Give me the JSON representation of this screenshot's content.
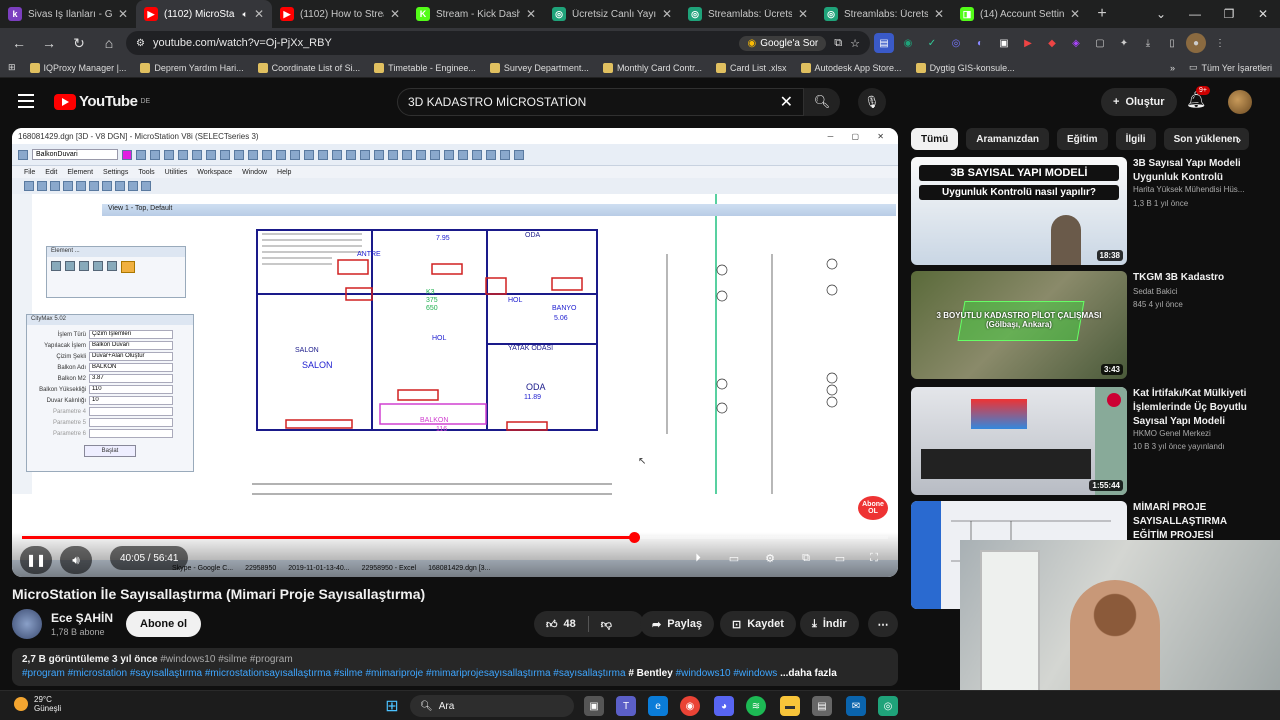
{
  "browser": {
    "tabs": [
      {
        "label": "Sivas İş İlanları - Gün",
        "color": "#7b3fbf",
        "glyph": "k",
        "active": false
      },
      {
        "label": "(1102) MicroSta",
        "color": "#ff0000",
        "glyph": "▶",
        "active": true
      },
      {
        "label": "(1102) How to Strea",
        "color": "#ff0000",
        "glyph": "▶",
        "active": false
      },
      {
        "label": "Stream - Kick Dashb",
        "color": "#53fc18",
        "glyph": "K",
        "active": false
      },
      {
        "label": "Ücretsiz Canlı Yayın v",
        "color": "#1fa37a",
        "glyph": "◎",
        "active": false
      },
      {
        "label": "Streamlabs: Ücretsiz",
        "color": "#1fa37a",
        "glyph": "◎",
        "active": false
      },
      {
        "label": "Streamlabs: Ücretsiz",
        "color": "#1fa37a",
        "glyph": "◎",
        "active": false
      },
      {
        "label": "(14) Account Setting",
        "color": "#53fc18",
        "glyph": "◨",
        "active": false
      }
    ],
    "new_tab": "+",
    "url": "youtube.com/watch?v=Oj-PjXx_RBY",
    "ask_google": "Google'a Sor",
    "bookmarks": [
      "IQProxy Manager |...",
      "Deprem Yardım Hari...",
      "Coordinate List of Si...",
      "Timetable - Enginee...",
      "Survey Department...",
      "Monthly Card Contr...",
      "Card List .xlsx",
      "Autodesk App Store...",
      "Dygtig GIS-konsule..."
    ],
    "bookmarks_more": "»",
    "all_bookmarks": "Tüm Yer İşaretleri"
  },
  "youtube": {
    "logo": "YouTube",
    "country": "DE",
    "search_query": "3D KADASTRO MİCROSTATİON",
    "create_label": "Oluştur",
    "notif_count": "9+"
  },
  "player": {
    "ms_title": "168081429.dgn [3D - V8 DGN] - MicroStation V8i (SELECTseries 3)",
    "ms_level": "BalkonDuvari",
    "ms_menus": [
      "File",
      "Edit",
      "Element",
      "Settings",
      "Tools",
      "Utilities",
      "Workspace",
      "Window",
      "Help"
    ],
    "view_title": "View 1 - Top, Default",
    "element_panel": "Element ...",
    "citymax_title": "CityMax 5.02",
    "citymax_rows": [
      {
        "label": "İşlem Türü",
        "value": "Çizim İşlemleri"
      },
      {
        "label": "Yapılacak İşlem",
        "value": "Balkon Duvarı"
      },
      {
        "label": "Çizim Şekli",
        "value": "Duvar+Alan Oluştur"
      },
      {
        "label": "Balkon Adı",
        "value": "BALKON"
      },
      {
        "label": "Balkon M2",
        "value": "3.87"
      },
      {
        "label": "Balkon Yüksekliği",
        "value": "110"
      },
      {
        "label": "Duvar Kalınlığı",
        "value": "10"
      },
      {
        "label": "Parametre 4",
        "value": ""
      },
      {
        "label": "Parametre 5",
        "value": ""
      },
      {
        "label": "Parametre 6",
        "value": ""
      }
    ],
    "citymax_start": "Başlat",
    "rooms": [
      "SALON",
      "ODA",
      "YATAK ODASI",
      "HOL",
      "BALKON",
      "BANYO",
      "ANTRE"
    ],
    "inner_taskbar": [
      "Skype - Google C...",
      "22958950",
      "2019-11-01-13-40...",
      "22958950 - Excel",
      "168081429.dgn [3..."
    ],
    "time_current": "40:05",
    "time_total": "56:41",
    "progress": 0.707,
    "abone": "Abone OL"
  },
  "video": {
    "title": "MicroStation İle Sayısallaştırma (Mimari Proje Sayısallaştırma)",
    "channel": "Ece ŞAHİN",
    "subscribers": "1,78 B abone",
    "subscribe_label": "Abone ol",
    "likes": "48",
    "share": "Paylaş",
    "save": "Kaydet",
    "download": "İndir",
    "views_time": "2,7 B görüntüleme  3 yıl önce",
    "hashtags_top": "#windows10 #silme #program",
    "tags_line": "#program #microstation #sayısallaştırma #microstationsayısallaştırma #silme #mimariproje #mimariprojesayısallaştırma #sayısallaştırma",
    "tags_tail": "# Bentley",
    "tags_after": "#windows10 #windows",
    "more": "...daha fazla"
  },
  "chips": [
    "Tümü",
    "Aramanızdan",
    "Eğitim",
    "İlgili",
    "Son yüklenen"
  ],
  "recommendations": [
    {
      "title": "3B Sayısal Yapı Modeli Uygunluk Kontrolü",
      "channel": "Harita Yüksek Mühendisi Hüs...",
      "meta": "1,3 B  1 yıl önce",
      "duration": "18:38",
      "thumb_text": "3B SAYISAL YAPI MODELİ",
      "thumb_text2": "Uygunluk Kontrolü nasıl yapılır?"
    },
    {
      "title": "TKGM 3B Kadastro",
      "channel": "Sedat Bakici",
      "meta": "845  4 yıl önce",
      "duration": "3:43",
      "thumb_text": "3 BOYUTLU KADASTRO PİLOT ÇALIŞMASI (Gölbaşı, Ankara)",
      "thumb_text2": ""
    },
    {
      "title": "Kat İrtifakı/Kat Mülkiyeti İşlemlerinde Üç Boyutlu Sayısal Yapı Modeli",
      "channel": "HKMO Genel Merkezi",
      "meta": "10 B  3 yıl önce yayınlandı",
      "duration": "1:55:44",
      "thumb_text": "",
      "thumb_text2": ""
    },
    {
      "title": "MİMARİ PROJE SAYISALLAŞTIRMA EĞİTİM PROJESİ",
      "channel": "",
      "meta": "",
      "duration": "",
      "thumb_text": "",
      "thumb_text2": ""
    }
  ],
  "taskbar": {
    "temp": "29°C",
    "weather": "Güneşli",
    "search": "Ara"
  }
}
